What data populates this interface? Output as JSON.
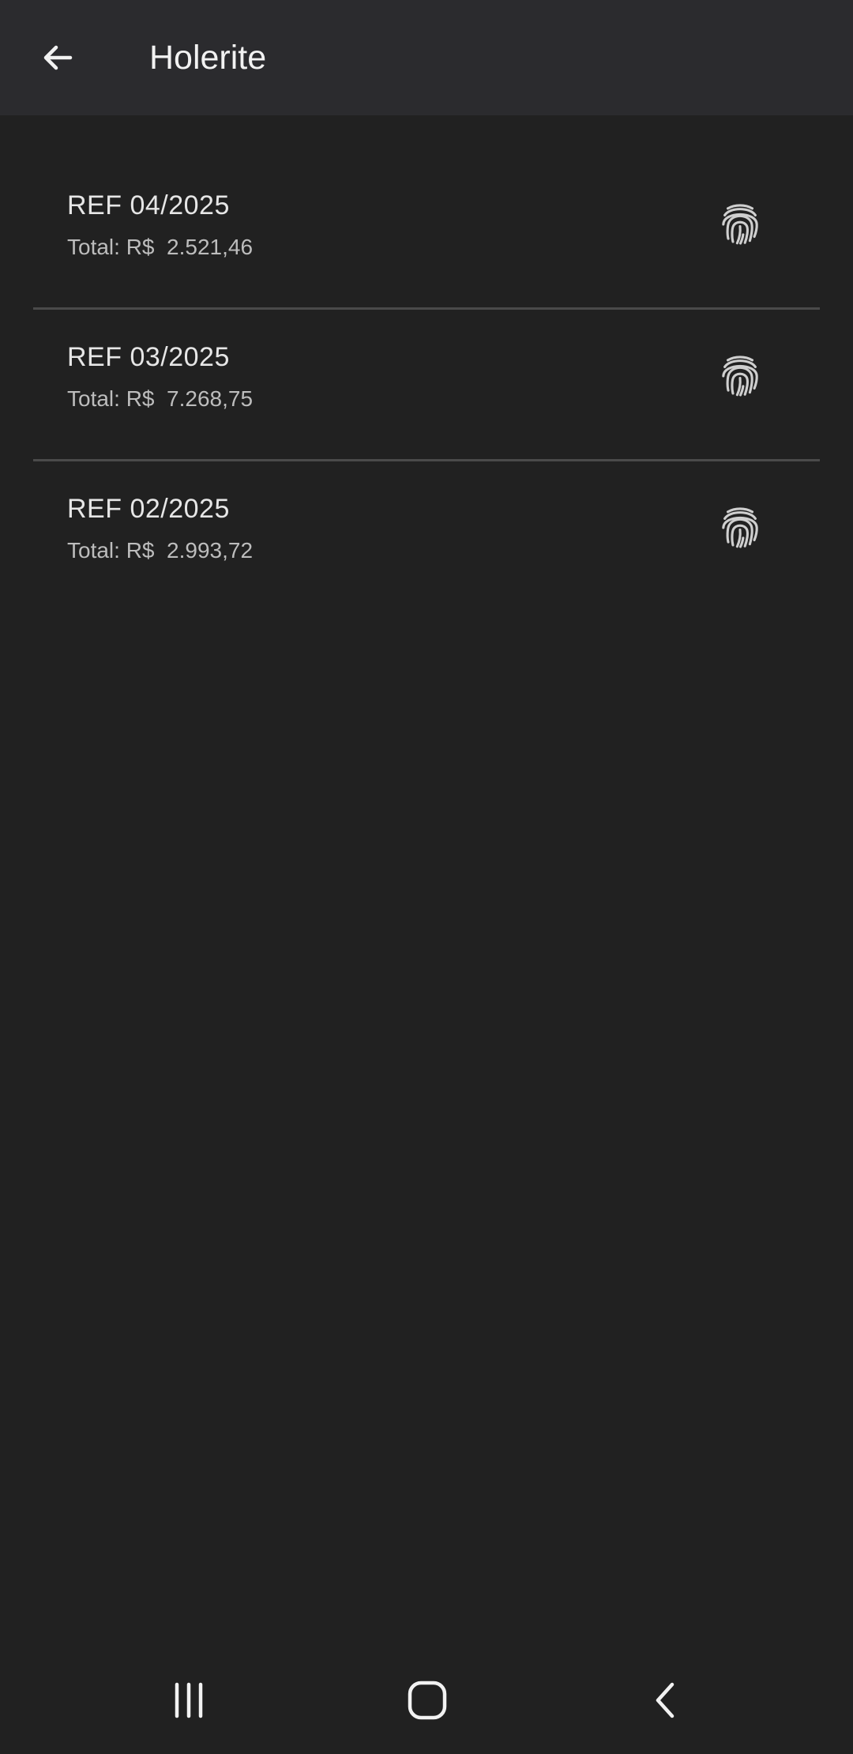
{
  "app_bar": {
    "title": "Holerite",
    "back_icon": "arrow-left-icon"
  },
  "payslips": [
    {
      "ref": "REF 04/2025",
      "total": "Total: R$  2.521,46",
      "icon": "fingerprint-icon"
    },
    {
      "ref": "REF 03/2025",
      "total": "Total: R$  7.268,75",
      "icon": "fingerprint-icon"
    },
    {
      "ref": "REF 02/2025",
      "total": "Total: R$  2.993,72",
      "icon": "fingerprint-icon"
    }
  ],
  "system_nav": {
    "recents_icon": "recents-icon",
    "home_icon": "home-icon",
    "back_icon": "system-back-icon"
  },
  "colors": {
    "background": "#212121",
    "app_bar": "#2b2b2e",
    "divider": "#4a4a4a",
    "primary_text": "#e6e6e6",
    "secondary_text": "#bdbdbd"
  }
}
